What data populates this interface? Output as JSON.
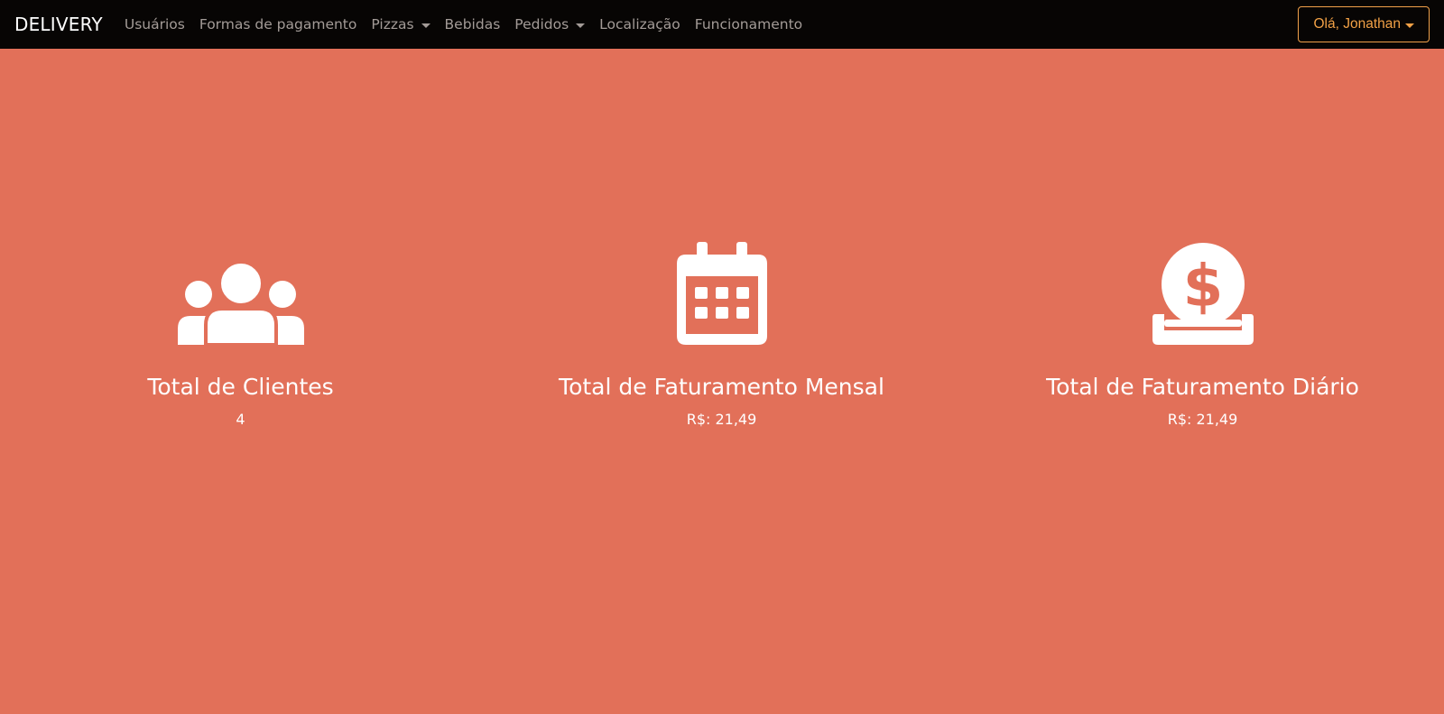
{
  "navbar": {
    "brand": "DELIVERY",
    "items": [
      {
        "label": "Usuários",
        "dropdown": false
      },
      {
        "label": "Formas de pagamento",
        "dropdown": false
      },
      {
        "label": "Pizzas",
        "dropdown": true
      },
      {
        "label": "Bebidas",
        "dropdown": false
      },
      {
        "label": "Pedidos",
        "dropdown": true
      },
      {
        "label": "Localização",
        "dropdown": false
      },
      {
        "label": "Funcionamento",
        "dropdown": false
      }
    ],
    "user_menu": "Olá, Jonathan"
  },
  "cards": [
    {
      "icon": "users-icon",
      "title": "Total de Clientes",
      "value": "4"
    },
    {
      "icon": "calendar-icon",
      "title": "Total de Faturamento Mensal",
      "value": "R$: 21,49"
    },
    {
      "icon": "money-deposit-icon",
      "title": "Total de Faturamento Diário",
      "value": "R$: 21,49"
    }
  ],
  "colors": {
    "background": "#e27059",
    "navbar": "#070504",
    "nav_link": "#a39b97",
    "accent": "#f2a146",
    "text": "#ffffff"
  }
}
